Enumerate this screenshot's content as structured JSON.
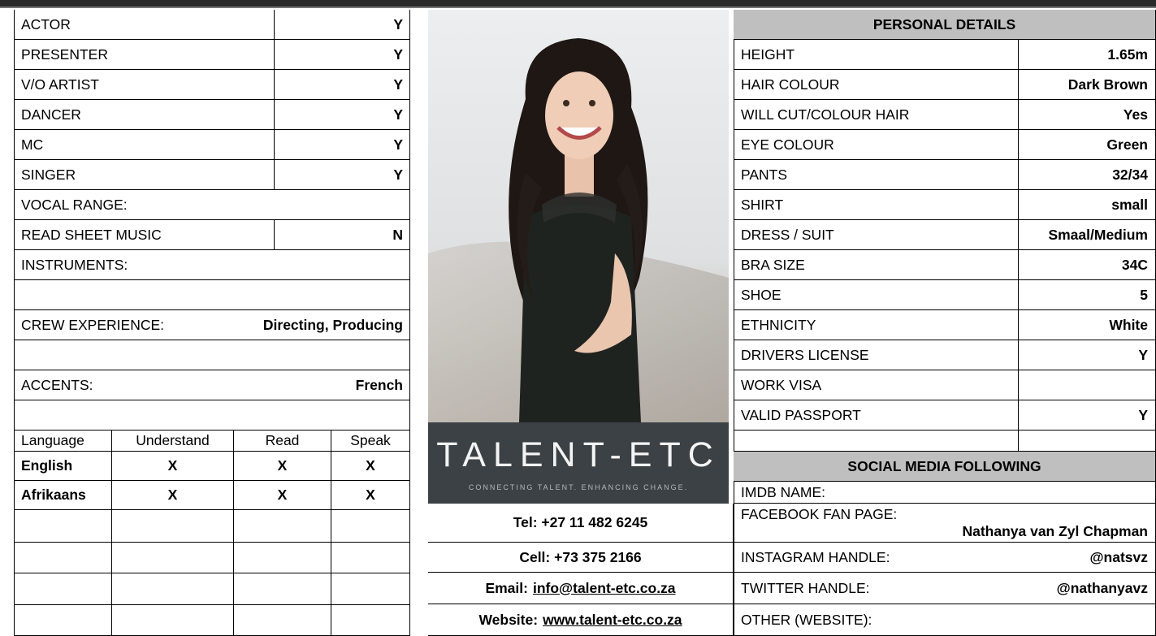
{
  "skills": [
    {
      "label": "ACTOR",
      "value": "Y"
    },
    {
      "label": "PRESENTER",
      "value": "Y"
    },
    {
      "label": "V/O ARTIST",
      "value": "Y"
    },
    {
      "label": "DANCER",
      "value": "Y"
    },
    {
      "label": "MC",
      "value": "Y"
    },
    {
      "label": "SINGER",
      "value": "Y"
    }
  ],
  "vocal_range_label": "VOCAL RANGE:",
  "read_music": {
    "label": "READ SHEET MUSIC",
    "value": "N"
  },
  "instruments_label": "INSTRUMENTS:",
  "crew": {
    "label": "CREW EXPERIENCE:",
    "value": "Directing, Producing"
  },
  "accents": {
    "label": "ACCENTS:",
    "value": "French"
  },
  "language_table": {
    "headers": [
      "Language",
      "Understand",
      "Read",
      "Speak"
    ],
    "rows": [
      [
        "English",
        "X",
        "X",
        "X"
      ],
      [
        "Afrikaans",
        "X",
        "X",
        "X"
      ]
    ]
  },
  "logo": {
    "main": "TALENT-ETC",
    "tagline": "CONNECTING TALENT. ENHANCING CHANGE."
  },
  "contact": {
    "tel": "Tel: +27 11 482 6245",
    "cell": "Cell: +73 375 2166",
    "email_label": "Email:",
    "email": "info@talent-etc.co.za",
    "website_label": "Website:",
    "website": "www.talent-etc.co.za"
  },
  "personal": {
    "header": "PERSONAL DETAILS",
    "rows": [
      {
        "label": "HEIGHT",
        "value": "1.65m"
      },
      {
        "label": "HAIR COLOUR",
        "value": "Dark Brown"
      },
      {
        "label": "WILL CUT/COLOUR HAIR",
        "value": "Yes"
      },
      {
        "label": "EYE COLOUR",
        "value": "Green"
      },
      {
        "label": "PANTS",
        "value": "32/34"
      },
      {
        "label": "SHIRT",
        "value": "small"
      },
      {
        "label": "DRESS / SUIT",
        "value": "Smaal/Medium"
      },
      {
        "label": "BRA SIZE",
        "value": "34C"
      },
      {
        "label": "SHOE",
        "value": "5"
      },
      {
        "label": "ETHNICITY",
        "value": "White"
      },
      {
        "label": "DRIVERS LICENSE",
        "value": "Y"
      },
      {
        "label": "WORK VISA",
        "value": ""
      },
      {
        "label": "VALID PASSPORT",
        "value": "Y"
      }
    ]
  },
  "social": {
    "header": "SOCIAL MEDIA FOLLOWING",
    "imdb_label": "IMDB NAME:",
    "facebook_label": "FACEBOOK FAN PAGE:",
    "facebook_value": "Nathanya van Zyl Chapman",
    "instagram_label": "INSTAGRAM HANDLE:",
    "instagram_value": "@natsvz",
    "twitter_label": "TWITTER HANDLE:",
    "twitter_value": "@nathanyavz",
    "other_label": "OTHER (WEBSITE):"
  }
}
